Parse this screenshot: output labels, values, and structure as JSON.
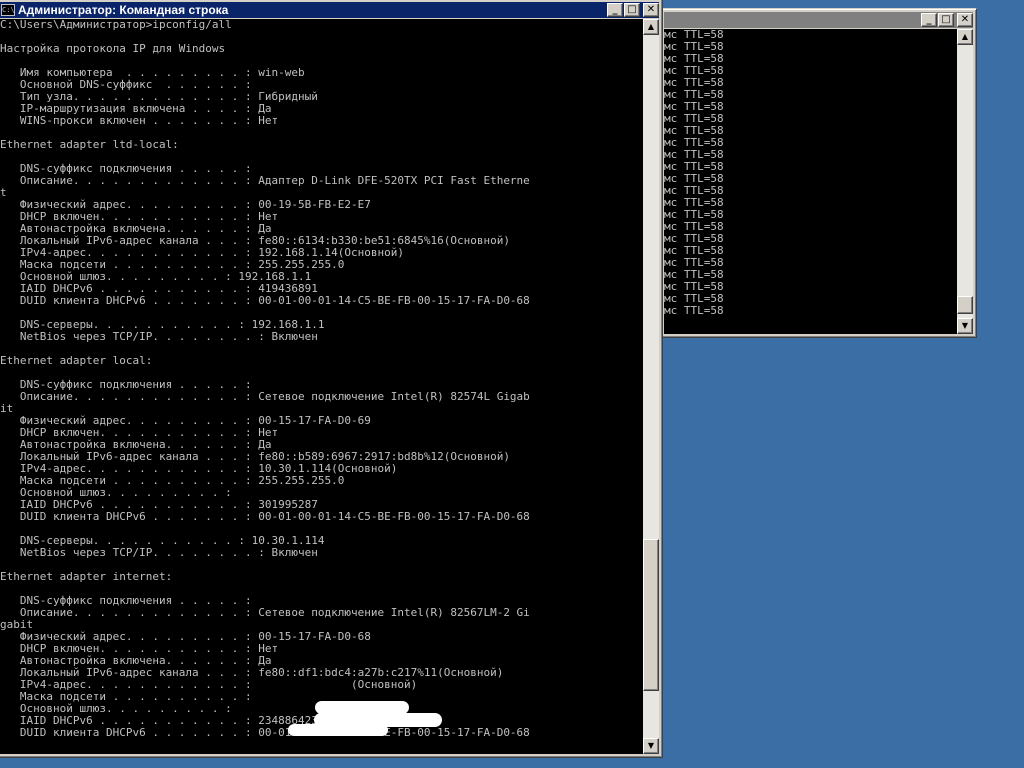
{
  "ping_window": {
    "title": "",
    "icon_text": "C:\\",
    "lines": [
      "мс TTL=58",
      "мс TTL=58",
      "мс TTL=58",
      "мс TTL=58",
      "мс TTL=58",
      "мс TTL=58",
      "мс TTL=58",
      "мс TTL=58",
      "мс TTL=58",
      "мс TTL=58",
      "мс TTL=58",
      "мс TTL=58",
      "мс TTL=58",
      "мс TTL=58",
      "мс TTL=58",
      "мс TTL=58",
      "мс TTL=58",
      "мс TTL=58",
      "мс TTL=58",
      "мс TTL=58",
      "мс TTL=58",
      "мс TTL=58",
      "мс TTL=58",
      "мс TTL=58"
    ],
    "scroll_position": 0.95
  },
  "main_window": {
    "title": "Администратор: Командная строка",
    "icon_text": "C:\\",
    "buttons": {
      "minimize": "_",
      "maximize": "□",
      "close": "✕"
    },
    "scroll_position": 0.92,
    "console_lines": [
      "C:\\Users\\Администратор>ipconfig/all",
      "",
      "Настройка протокола IP для Windows",
      "",
      "   Имя компьютера  . . . . . . . . . : win-web",
      "   Основной DNS-суффикс  . . . . . . :",
      "   Тип узла. . . . . . . . . . . . . : Гибридный",
      "   IP-маршрутизация включена . . . . : Да",
      "   WINS-прокси включен . . . . . . . : Нет",
      "",
      "Ethernet adapter ltd-local:",
      "",
      "   DNS-суффикс подключения . . . . . :",
      "   Описание. . . . . . . . . . . . . : Адаптер D-Link DFE-520TX PCI Fast Etherne",
      "t",
      "   Физический адрес. . . . . . . . . : 00-19-5B-FB-E2-E7",
      "   DHCP включен. . . . . . . . . . . : Нет",
      "   Автонастройка включена. . . . . . : Да",
      "   Локальный IPv6-адрес канала . . . : fe80::6134:b330:be51:6845%16(Основной)",
      "   IPv4-адрес. . . . . . . . . . . . : 192.168.1.14(Основной)",
      "   Маска подсети . . . . . . . . . . : 255.255.255.0",
      "   Основной шлюз. . . . . . . . . : 192.168.1.1",
      "   IAID DHCPv6 . . . . . . . . . . . : 419436891",
      "   DUID клиента DHCPv6 . . . . . . . : 00-01-00-01-14-C5-BE-FB-00-15-17-FA-D0-68",
      "",
      "   DNS-серверы. . . . . . . . . . . : 192.168.1.1",
      "   NetBios через TCP/IP. . . . . . . . : Включен",
      "",
      "Ethernet adapter local:",
      "",
      "   DNS-суффикс подключения . . . . . :",
      "   Описание. . . . . . . . . . . . . : Сетевое подключение Intel(R) 82574L Gigab",
      "it",
      "   Физический адрес. . . . . . . . . : 00-15-17-FA-D0-69",
      "   DHCP включен. . . . . . . . . . . : Нет",
      "   Автонастройка включена. . . . . . : Да",
      "   Локальный IPv6-адрес канала . . . : fe80::b589:6967:2917:bd8b%12(Основной)",
      "   IPv4-адрес. . . . . . . . . . . . : 10.30.1.114(Основной)",
      "   Маска подсети . . . . . . . . . . : 255.255.255.0",
      "   Основной шлюз. . . . . . . . . :",
      "   IAID DHCPv6 . . . . . . . . . . . : 301995287",
      "   DUID клиента DHCPv6 . . . . . . . : 00-01-00-01-14-C5-BE-FB-00-15-17-FA-D0-68",
      "",
      "   DNS-серверы. . . . . . . . . . . : 10.30.1.114",
      "   NetBios через TCP/IP. . . . . . . . : Включен",
      "",
      "Ethernet adapter internet:",
      "",
      "   DNS-суффикс подключения . . . . . :",
      "   Описание. . . . . . . . . . . . . : Сетевое подключение Intel(R) 82567LM-2 Gi",
      "gabit",
      "   Физический адрес. . . . . . . . . : 00-15-17-FA-D0-68",
      "   DHCP включен. . . . . . . . . . . : Нет",
      "   Автонастройка включена. . . . . . : Да",
      "   Локальный IPv6-адрес канала . . . : fe80::df1:bdc4:a27b:c217%11(Основной)",
      "   IPv4-адрес. . . . . . . . . . . . :               (Основной)",
      "   Маска подсети . . . . . . . . . . :",
      "   Основной шлюз. . . . . . . . . :",
      "   IAID DHCPv6 . . . . . . . . . . . : 234886423",
      "   DUID клиента DHCPv6 . . . . . . . : 00-01-00-01-14-C5-BE-FB-00-15-17-FA-D0-68"
    ]
  }
}
